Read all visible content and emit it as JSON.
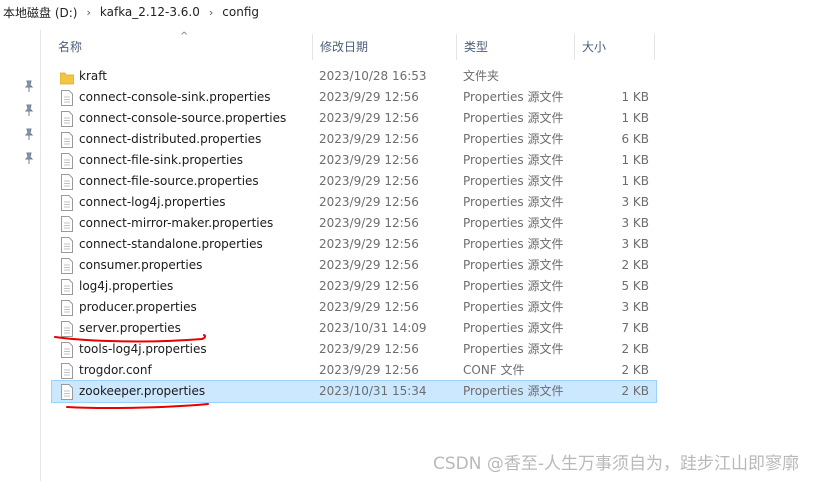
{
  "breadcrumb": [
    "本地磁盘 (D:)",
    "kafka_2.12-3.6.0",
    "config"
  ],
  "columns": {
    "name": "名称",
    "date": "修改日期",
    "type": "类型",
    "size": "大小"
  },
  "files": [
    {
      "name": "kraft",
      "date": "2023/10/28 16:53",
      "type": "文件夹",
      "size": "",
      "icon": "folder-icon"
    },
    {
      "name": "connect-console-sink.properties",
      "date": "2023/9/29 12:56",
      "type": "Properties 源文件",
      "size": "1 KB",
      "icon": "file-icon"
    },
    {
      "name": "connect-console-source.properties",
      "date": "2023/9/29 12:56",
      "type": "Properties 源文件",
      "size": "1 KB",
      "icon": "file-icon"
    },
    {
      "name": "connect-distributed.properties",
      "date": "2023/9/29 12:56",
      "type": "Properties 源文件",
      "size": "6 KB",
      "icon": "file-icon"
    },
    {
      "name": "connect-file-sink.properties",
      "date": "2023/9/29 12:56",
      "type": "Properties 源文件",
      "size": "1 KB",
      "icon": "file-icon"
    },
    {
      "name": "connect-file-source.properties",
      "date": "2023/9/29 12:56",
      "type": "Properties 源文件",
      "size": "1 KB",
      "icon": "file-icon"
    },
    {
      "name": "connect-log4j.properties",
      "date": "2023/9/29 12:56",
      "type": "Properties 源文件",
      "size": "3 KB",
      "icon": "file-icon"
    },
    {
      "name": "connect-mirror-maker.properties",
      "date": "2023/9/29 12:56",
      "type": "Properties 源文件",
      "size": "3 KB",
      "icon": "file-icon"
    },
    {
      "name": "connect-standalone.properties",
      "date": "2023/9/29 12:56",
      "type": "Properties 源文件",
      "size": "3 KB",
      "icon": "file-icon"
    },
    {
      "name": "consumer.properties",
      "date": "2023/9/29 12:56",
      "type": "Properties 源文件",
      "size": "2 KB",
      "icon": "file-icon"
    },
    {
      "name": "log4j.properties",
      "date": "2023/9/29 12:56",
      "type": "Properties 源文件",
      "size": "5 KB",
      "icon": "file-icon"
    },
    {
      "name": "producer.properties",
      "date": "2023/9/29 12:56",
      "type": "Properties 源文件",
      "size": "3 KB",
      "icon": "file-icon"
    },
    {
      "name": "server.properties",
      "date": "2023/10/31 14:09",
      "type": "Properties 源文件",
      "size": "7 KB",
      "icon": "file-icon"
    },
    {
      "name": "tools-log4j.properties",
      "date": "2023/9/29 12:56",
      "type": "Properties 源文件",
      "size": "2 KB",
      "icon": "file-icon"
    },
    {
      "name": "trogdor.conf",
      "date": "2023/9/29 12:56",
      "type": "CONF 文件",
      "size": "2 KB",
      "icon": "file-icon"
    },
    {
      "name": "zookeeper.properties",
      "date": "2023/10/31 15:34",
      "type": "Properties 源文件",
      "size": "2 KB",
      "icon": "file-icon",
      "selected": true
    }
  ],
  "colors": {
    "selection": "#cce8ff",
    "selection_border": "#99d1ff",
    "annotation": "#e60000",
    "folder": "#f5c542"
  },
  "watermark": "CSDN @香至-人生万事须自为，跬步江山即寥廓"
}
